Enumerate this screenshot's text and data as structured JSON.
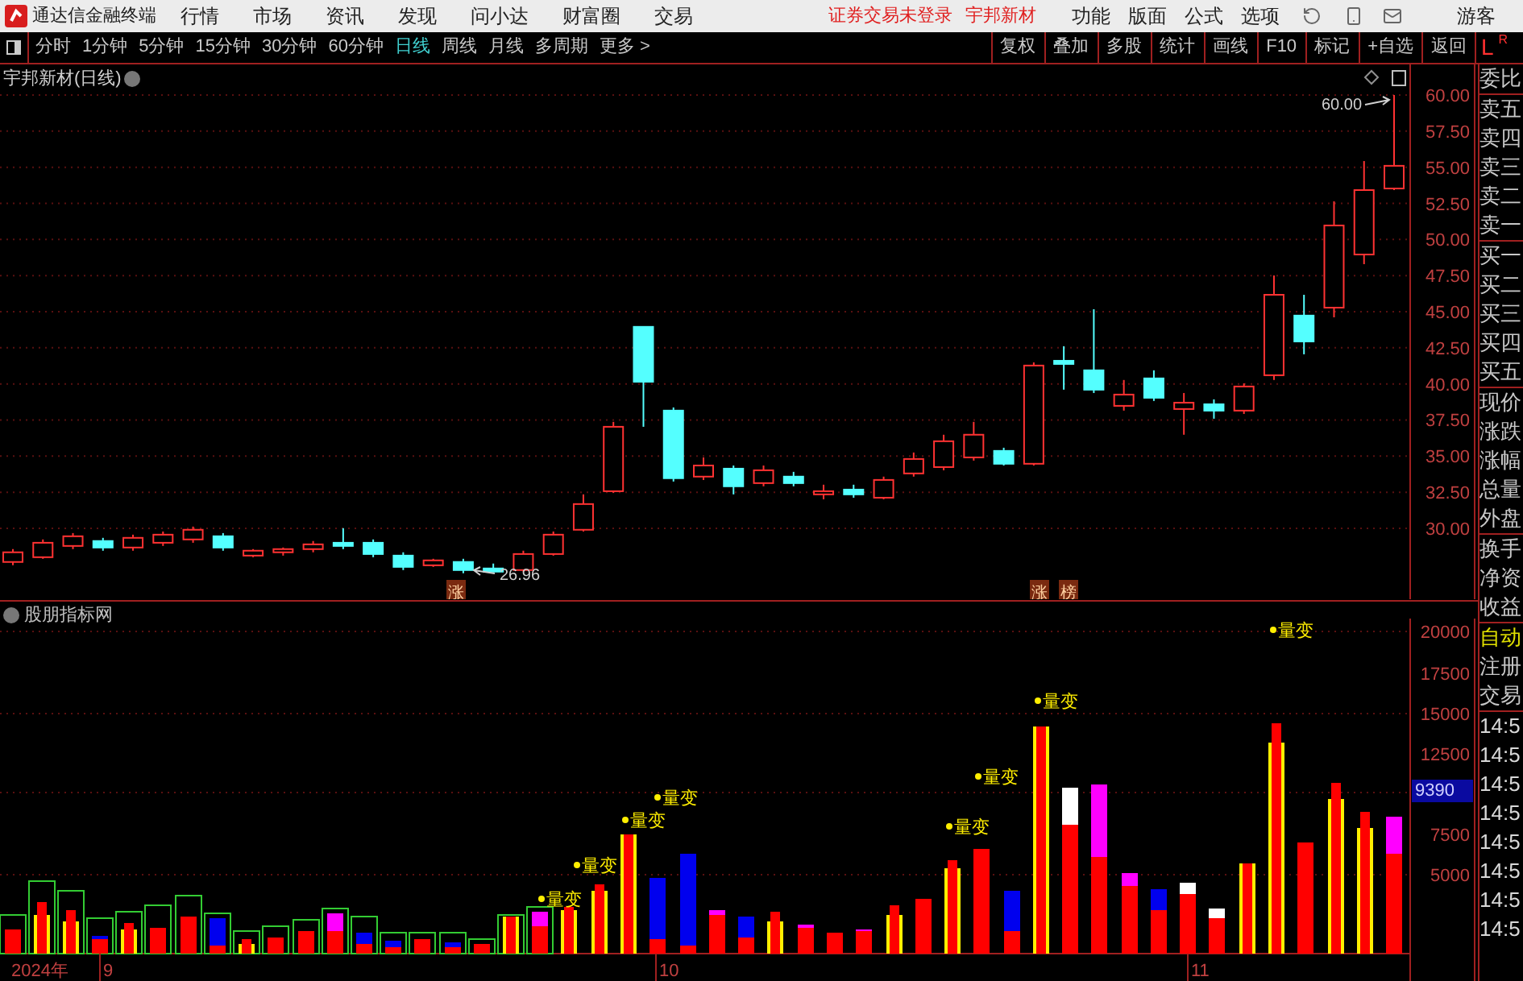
{
  "app": {
    "title": "通达信金融终端"
  },
  "menu": [
    "行情",
    "市场",
    "资讯",
    "发现",
    "问小达",
    "财富圈",
    "交易"
  ],
  "login_status": "证券交易未登录",
  "stock_name": "宇邦新材",
  "menu_right": [
    "功能",
    "版面",
    "公式",
    "选项"
  ],
  "user": "游客",
  "periods": [
    {
      "label": "分时",
      "selected": false
    },
    {
      "label": "1分钟",
      "selected": false
    },
    {
      "label": "5分钟",
      "selected": false
    },
    {
      "label": "15分钟",
      "selected": false
    },
    {
      "label": "30分钟",
      "selected": false
    },
    {
      "label": "60分钟",
      "selected": false
    },
    {
      "label": "日线",
      "selected": true
    },
    {
      "label": "周线",
      "selected": false
    },
    {
      "label": "月线",
      "selected": false
    },
    {
      "label": "多周期",
      "selected": false
    },
    {
      "label": "更多 >",
      "selected": false
    }
  ],
  "toolbar_buttons": [
    "复权",
    "叠加",
    "多股",
    "统计",
    "画线",
    "F10",
    "标记",
    "+自选",
    "返回"
  ],
  "panel_toggle": {
    "left": "L",
    "right": "R"
  },
  "price_chart": {
    "title": "宇邦新材(日线)",
    "chart_data": {
      "type": "candlestick",
      "grid": true,
      "ylim": [
        25.09,
        62.12
      ],
      "yticks": [
        {
          "value": 30,
          "label": "30.00"
        },
        {
          "value": 32.5,
          "label": "32.50"
        },
        {
          "value": 35,
          "label": "35.00"
        },
        {
          "value": 37.5,
          "label": "37.50"
        },
        {
          "value": 40,
          "label": "40.00"
        },
        {
          "value": 42.5,
          "label": "42.50"
        },
        {
          "value": 45,
          "label": "45.00"
        },
        {
          "value": 47.5,
          "label": "47.50"
        },
        {
          "value": 50,
          "label": "50.00"
        },
        {
          "value": 52.5,
          "label": "52.50"
        },
        {
          "value": 55,
          "label": "55.00"
        },
        {
          "value": 57.5,
          "label": "57.50"
        },
        {
          "value": 60,
          "label": "60.00"
        }
      ],
      "ohlc": [
        [
          27.67,
          28.56,
          27.44,
          28.34
        ],
        [
          28.0,
          29.23,
          27.89,
          29.0
        ],
        [
          28.78,
          29.67,
          28.56,
          29.45
        ],
        [
          29.12,
          29.34,
          28.45,
          28.67
        ],
        [
          28.67,
          29.56,
          28.45,
          29.34
        ],
        [
          29.0,
          29.78,
          28.78,
          29.56
        ],
        [
          29.23,
          30.12,
          29.0,
          29.9
        ],
        [
          29.45,
          29.67,
          28.45,
          28.67
        ],
        [
          28.11,
          28.56,
          28.0,
          28.45
        ],
        [
          28.34,
          28.67,
          28.11,
          28.56
        ],
        [
          28.56,
          29.12,
          28.34,
          28.89
        ],
        [
          29.0,
          30.01,
          28.56,
          28.78
        ],
        [
          29.0,
          29.23,
          28.0,
          28.22
        ],
        [
          28.11,
          28.34,
          27.11,
          27.33
        ],
        [
          27.44,
          27.89,
          27.33,
          27.78
        ],
        [
          27.67,
          27.89,
          26.89,
          27.11
        ],
        [
          27.22,
          27.56,
          26.96,
          27.0
        ],
        [
          27.11,
          28.45,
          27.0,
          28.22
        ],
        [
          28.22,
          29.78,
          28.11,
          29.56
        ],
        [
          29.9,
          32.35,
          29.78,
          31.68
        ],
        [
          32.57,
          37.37,
          32.46,
          37.03
        ],
        [
          43.95,
          43.95,
          37.03,
          40.15
        ],
        [
          38.15,
          38.37,
          33.24,
          33.47
        ],
        [
          33.58,
          34.91,
          33.35,
          34.35
        ],
        [
          34.13,
          34.35,
          32.35,
          32.91
        ],
        [
          33.13,
          34.35,
          32.91,
          34.02
        ],
        [
          33.58,
          33.91,
          32.91,
          33.13
        ],
        [
          32.35,
          33.02,
          32.01,
          32.57
        ],
        [
          32.68,
          33.02,
          32.12,
          32.35
        ],
        [
          32.12,
          33.58,
          32.01,
          33.35
        ],
        [
          33.8,
          35.25,
          33.58,
          34.8
        ],
        [
          34.24,
          36.48,
          34.02,
          36.03
        ],
        [
          34.91,
          37.37,
          34.69,
          36.48
        ],
        [
          35.36,
          35.58,
          34.35,
          34.47
        ],
        [
          34.47,
          41.49,
          34.35,
          41.27
        ],
        [
          41.6,
          42.61,
          39.6,
          41.38
        ],
        [
          40.94,
          45.17,
          39.37,
          39.6
        ],
        [
          38.48,
          40.27,
          38.15,
          39.26
        ],
        [
          40.38,
          40.94,
          38.82,
          39.04
        ],
        [
          38.26,
          39.37,
          36.48,
          38.7
        ],
        [
          38.59,
          38.93,
          37.59,
          38.15
        ],
        [
          38.15,
          40.04,
          37.92,
          39.82
        ],
        [
          40.6,
          47.51,
          40.27,
          46.17
        ],
        [
          44.73,
          46.17,
          42.05,
          42.94
        ],
        [
          45.28,
          52.64,
          44.61,
          50.97
        ],
        [
          48.96,
          55.43,
          48.29,
          53.42
        ],
        [
          53.53,
          60.0,
          53.42,
          55.1
        ]
      ]
    },
    "high_label": "60.00",
    "low_label": "26.96",
    "badges": [
      "涨",
      "涨",
      "榜"
    ]
  },
  "volume_chart": {
    "title": "股朋指标网",
    "y_axis": [
      "20000",
      "17500",
      "15000",
      "12500",
      "7500",
      "5000"
    ],
    "current_value": "9390",
    "signals": [
      "量变",
      "量变",
      "量变",
      "量变",
      "量变",
      "量变",
      "量变",
      "量变"
    ],
    "x_axis": [
      "2024年",
      "9",
      "10",
      "11"
    ]
  },
  "quote_panel": {
    "groups": [
      [
        "委比"
      ],
      [
        "卖五",
        "卖四",
        "卖三",
        "卖二",
        "卖一"
      ],
      [
        "买一",
        "买二",
        "买三",
        "买四",
        "买五"
      ],
      [
        "现价",
        "涨跌",
        "涨幅",
        "总量",
        "外盘"
      ],
      [
        "换手",
        "净资",
        "收益"
      ]
    ],
    "mode": "自动",
    "links": [
      "注册",
      "交易"
    ],
    "times": [
      "14:5",
      "14:5",
      "14:5",
      "14:5",
      "14:5",
      "14:5",
      "14:5",
      "14:5"
    ]
  }
}
